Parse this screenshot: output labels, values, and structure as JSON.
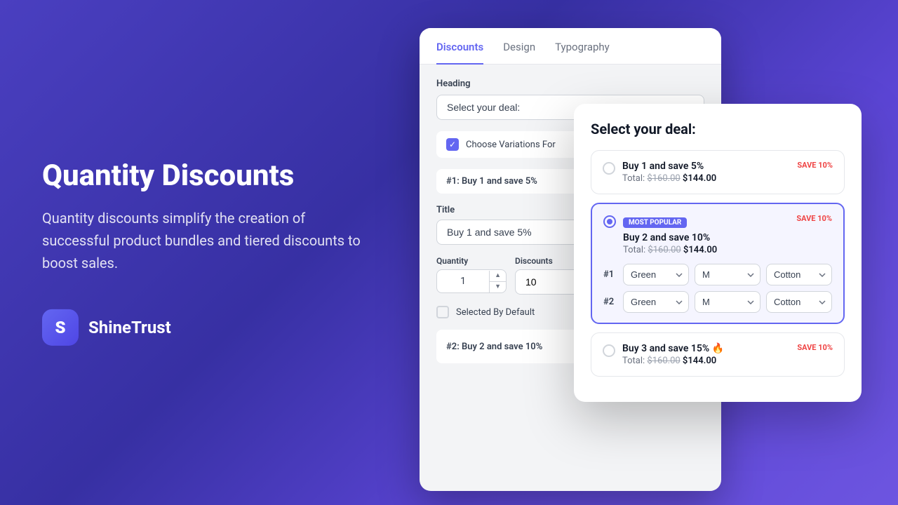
{
  "background": {
    "gradient_start": "#4a3fc0",
    "gradient_end": "#6d55e0"
  },
  "left_panel": {
    "title": "Quantity Discounts",
    "description": "Quantity discounts simplify the creation of successful product bundles and tiered discounts to boost sales."
  },
  "brand": {
    "logo_letter": "S",
    "name": "ShineTrust"
  },
  "main_card": {
    "tabs": [
      {
        "label": "Discounts",
        "active": true
      },
      {
        "label": "Design",
        "active": false
      },
      {
        "label": "Typography",
        "active": false
      }
    ],
    "heading_section": {
      "label": "Heading",
      "placeholder": "Select your deal:"
    },
    "choose_variations": {
      "label": "Choose Variations For"
    },
    "discount1": {
      "label": "#1: Buy 1 and save 5%"
    },
    "title_section": {
      "label": "Title",
      "value": "Buy 1 and save 5%"
    },
    "quantity_section": {
      "label": "Quantity",
      "value": "1"
    },
    "discount_section": {
      "label": "Discounts",
      "value": "10"
    },
    "selected_by_default": {
      "label": "Selected By Default"
    },
    "discount2": {
      "label": "#2: Buy 2 and save 10%"
    }
  },
  "overlay_card": {
    "heading": "Select your deal:",
    "options": [
      {
        "id": 1,
        "selected": false,
        "title": "Buy 1 and save 5%",
        "save_badge": "SAVE 10%",
        "total_label": "Total:",
        "original_price": "$160.00",
        "discounted_price": "$144.00",
        "most_popular": false,
        "has_fire": false,
        "variations": []
      },
      {
        "id": 2,
        "selected": true,
        "title": "Buy 2 and save 10%",
        "save_badge": "SAVE 10%",
        "total_label": "Total:",
        "original_price": "$160.00",
        "discounted_price": "$144.00",
        "most_popular": true,
        "most_popular_label": "MOST POPULAR",
        "has_fire": false,
        "variations": [
          {
            "num": "#1",
            "color": "Green",
            "size": "M",
            "material": "Cotton"
          },
          {
            "num": "#2",
            "color": "Green",
            "size": "M",
            "material": "Cotton"
          }
        ]
      },
      {
        "id": 3,
        "selected": false,
        "title": "Buy 3 and save 15%",
        "save_badge": "SAVE 10%",
        "total_label": "Total:",
        "original_price": "$160.00",
        "discounted_price": "$144.00",
        "most_popular": false,
        "has_fire": true,
        "variations": []
      }
    ]
  }
}
